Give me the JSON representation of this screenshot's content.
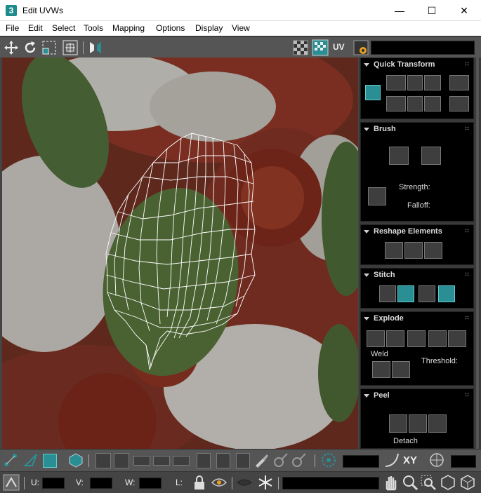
{
  "window": {
    "title": "Edit UVWs",
    "app_icon_text": "3",
    "minimize": "—",
    "maximize": "☐",
    "close": "✕"
  },
  "menu": [
    "File",
    "Edit",
    "Select",
    "Tools",
    "Mapping",
    "Options",
    "Display",
    "View"
  ],
  "toolbar": {
    "uv_label": "UV"
  },
  "panel": {
    "quick_transform": {
      "title": "Quick Transform"
    },
    "brush": {
      "title": "Brush",
      "strength_label": "Strength:",
      "falloff_label": "Falloff:"
    },
    "reshape": {
      "title": "Reshape Elements"
    },
    "stitch": {
      "title": "Stitch"
    },
    "explode": {
      "title": "Explode",
      "weld_label": "Weld",
      "threshold_label": "Threshold:"
    },
    "peel": {
      "title": "Peel",
      "detach_label": "Detach"
    }
  },
  "bottom": {
    "xy_label": "XY",
    "u_label": "U:",
    "v_label": "V:",
    "w_label": "W:",
    "l_label": "L:",
    "u_value": "",
    "v_value": "",
    "w_value": ""
  },
  "colors": {
    "accent": "#2a8f95",
    "panel_bg": "#000000",
    "toolbar_bg": "#555555"
  }
}
